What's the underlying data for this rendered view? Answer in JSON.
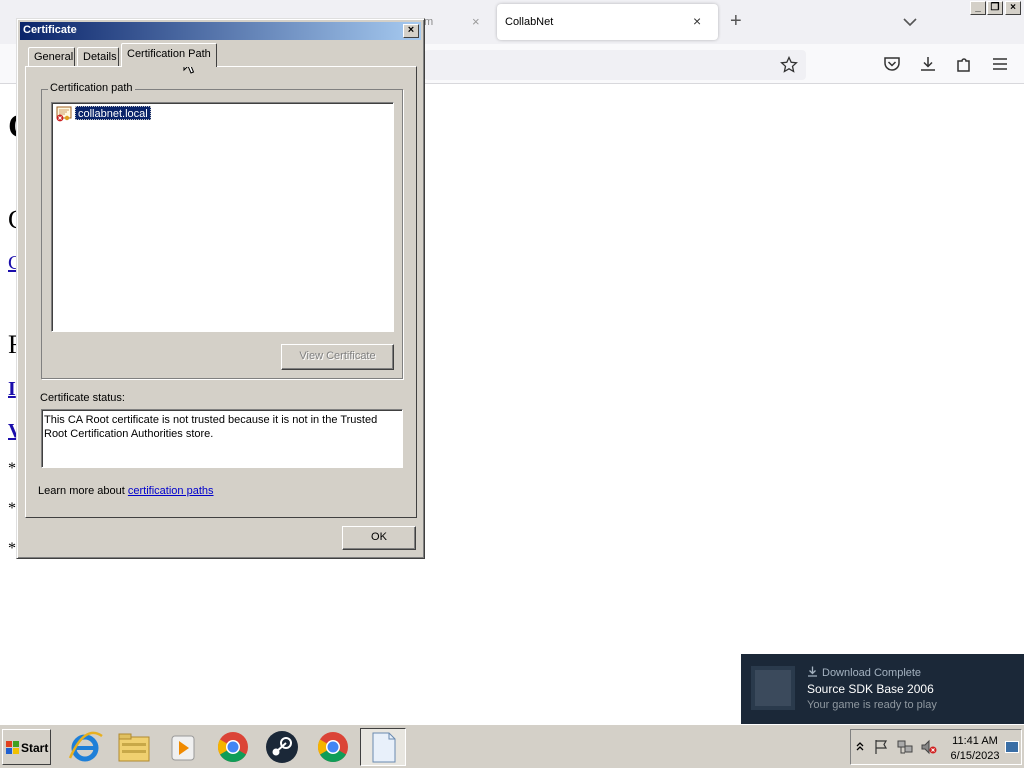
{
  "browser": {
    "inactive_tab_fragment": "m",
    "active_tab_title": "CollabNet",
    "tab_close_glyph": "×",
    "new_tab_glyph": "+"
  },
  "dialog": {
    "title": "Certificate",
    "close_glyph": "×",
    "tabs": [
      {
        "label": "General"
      },
      {
        "label": "Details"
      },
      {
        "label": "Certification Path"
      }
    ],
    "active_tab": "Certification Path",
    "path_group_label": "Certification path",
    "path_items": [
      {
        "label": "collabnet.local",
        "icon": "certificate-error-icon",
        "selected": true
      }
    ],
    "view_certificate_label": "View Certificate",
    "status_label": "Certificate status:",
    "status_text": "This CA Root certificate is not trusted because it is not in the Trusted Root Certification Authorities store.",
    "learn_more_prefix": "Learn more about",
    "learn_more_link": "certification paths",
    "ok_label": "OK"
  },
  "notification": {
    "line1": "Download Complete",
    "line2": "Source SDK Base 2006",
    "line3": "Your game is ready to play",
    "icon": "download-icon"
  },
  "taskbar": {
    "start_label": "Start",
    "apps": [
      {
        "name": "internet-explorer-icon"
      },
      {
        "name": "file-explorer-icon"
      },
      {
        "name": "media-player-icon"
      },
      {
        "name": "chrome-icon"
      },
      {
        "name": "steam-icon"
      },
      {
        "name": "chrome-icon"
      },
      {
        "name": "document-icon"
      }
    ],
    "clock_time": "11:41 AM",
    "clock_date": "6/15/2023"
  },
  "colors": {
    "title_bar_start": "#0a246a",
    "title_bar_end": "#a6caf0",
    "selection": "#0a246a",
    "link": "#0000cc",
    "toast_bg": "#1b2838"
  }
}
